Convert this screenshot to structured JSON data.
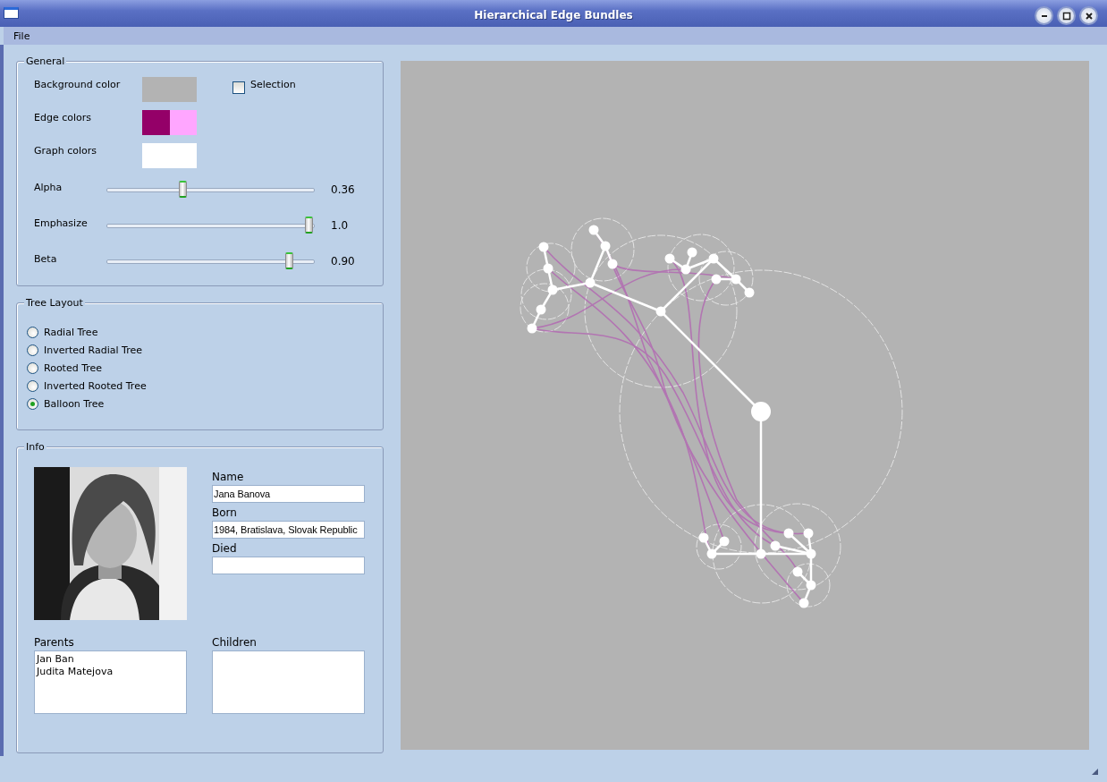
{
  "window": {
    "title": "Hierarchical Edge Bundles"
  },
  "menu": [
    "File"
  ],
  "general": {
    "title": "General",
    "color_rows": [
      {
        "label": "Background color",
        "swatches": [
          {
            "color": "#b3b3b3"
          }
        ]
      },
      {
        "label": "Edge colors",
        "swatches": [
          {
            "color": "#940068"
          },
          {
            "color": "#ffa6ff"
          }
        ]
      },
      {
        "label": "Graph colors",
        "swatches": [
          {
            "color": "#ffffff"
          }
        ]
      }
    ],
    "selection": {
      "label": "Selection",
      "checked": false
    },
    "sliders": [
      {
        "label": "Alpha",
        "level": 0.36,
        "reading": "0.36"
      },
      {
        "label": "Emphasize",
        "level": 1.0,
        "reading": "1.0"
      },
      {
        "label": "Beta",
        "level": 0.9,
        "reading": "0.90"
      }
    ]
  },
  "tree_layout": {
    "title": "Tree Layout",
    "options": [
      {
        "label": "Radial Tree",
        "selected": false
      },
      {
        "label": "Inverted Radial Tree",
        "selected": false
      },
      {
        "label": "Rooted Tree",
        "selected": false
      },
      {
        "label": "Inverted Rooted Tree",
        "selected": false
      },
      {
        "label": "Balloon Tree",
        "selected": true
      }
    ]
  },
  "info": {
    "title": "Info",
    "fields": [
      {
        "label": "Name",
        "value": "Jana Banova"
      },
      {
        "label": "Born",
        "value": "1984, Bratislava, Slovak Republic"
      },
      {
        "label": "Died"
      }
    ],
    "lists": [
      {
        "label": "Parents",
        "items": [
          "Jan Ban",
          "Judita Matejova"
        ]
      },
      {
        "label": "Children"
      }
    ]
  }
}
